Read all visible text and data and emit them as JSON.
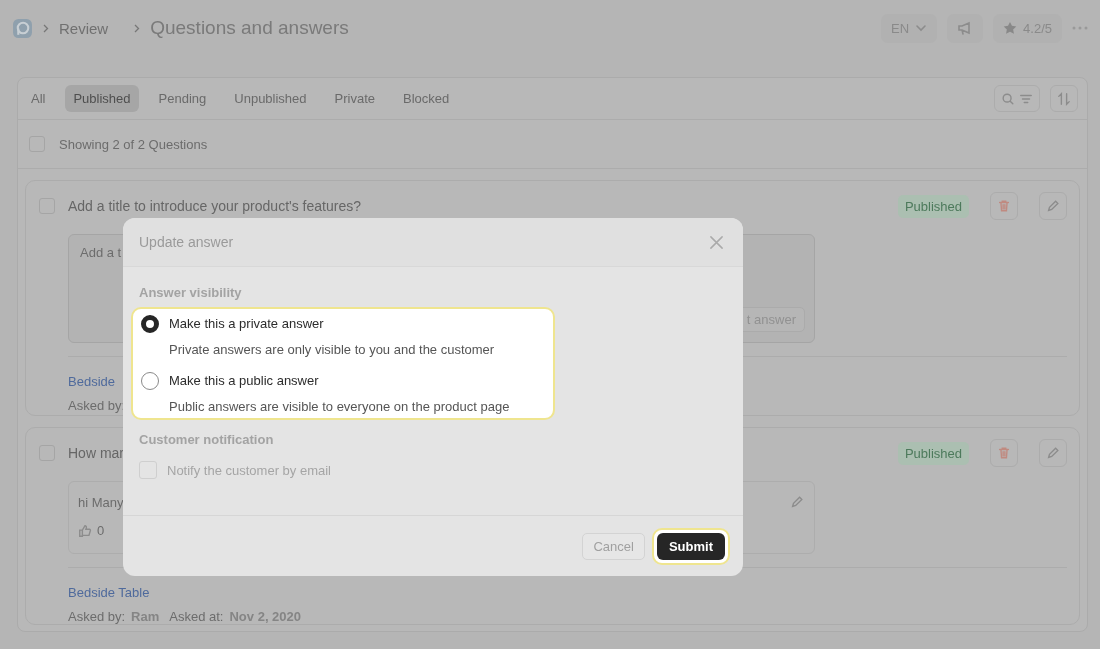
{
  "header": {
    "breadcrumb": [
      {
        "label": "Review"
      }
    ],
    "title": "Questions and answers",
    "language": "EN",
    "rating": "4.2/5"
  },
  "tabs": [
    {
      "label": "All",
      "selected": false
    },
    {
      "label": "Published",
      "selected": true
    },
    {
      "label": "Pending",
      "selected": false
    },
    {
      "label": "Unpublished",
      "selected": false
    },
    {
      "label": "Private",
      "selected": false
    },
    {
      "label": "Blocked",
      "selected": false
    }
  ],
  "list_header": {
    "checked": false,
    "text": "Showing 2 of 2 Questions"
  },
  "questions": [
    {
      "checked": false,
      "title": "Add a title to introduce your product's features?",
      "status": "Published",
      "answer": {
        "kind": "editor",
        "placeholder": "Add a t",
        "button": "t answer"
      },
      "product": "Bedside",
      "asked_by_label": "Asked by:"
    },
    {
      "checked": false,
      "title": "How mar",
      "status": "Published",
      "answer": {
        "kind": "answer",
        "text": "hi Many",
        "likes": "0"
      },
      "product": "Bedside Table",
      "asked_by_label": "Asked by:",
      "asked_by": "Ram",
      "asked_at_label": "Asked at:",
      "asked_at": "Nov 2, 2020"
    }
  ],
  "dialog": {
    "title": "Update answer",
    "visibility_label": "Answer visibility",
    "visibility_highlighted": true,
    "options": [
      {
        "label": "Make this a private answer",
        "description": "Private answers are only visible to you and the customer",
        "selected": true
      },
      {
        "label": "Make this a public answer",
        "description": "Public answers are visible to everyone on the product page",
        "selected": false
      }
    ],
    "notification_label": "Customer notification",
    "notify": {
      "label": "Notify the customer by email",
      "checked": false
    },
    "cancel": "Cancel",
    "submit": {
      "label": "Submit",
      "highlighted": true
    }
  }
}
